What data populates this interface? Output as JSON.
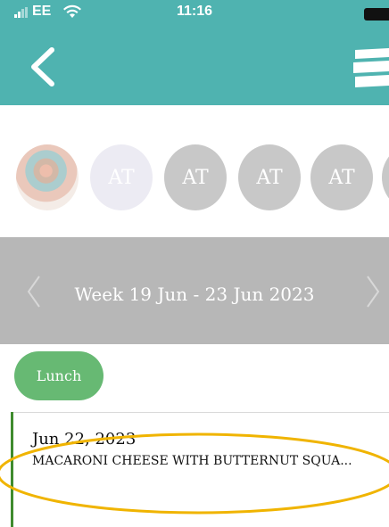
{
  "status_bar": {
    "carrier": "EE",
    "time": "11:16",
    "icons": [
      "signal-icon",
      "wifi-icon",
      "battery-icon"
    ]
  },
  "nav_bar": {
    "back_icon": "chevron-left-icon",
    "menu_icon": "menu-icon",
    "color": "#4fb3b0"
  },
  "children": [
    {
      "type": "photo"
    },
    {
      "initials": "AT",
      "selected": true
    },
    {
      "initials": "AT"
    },
    {
      "initials": "AT"
    },
    {
      "initials": "AT"
    }
  ],
  "week": {
    "label": "Week 19 Jun - 23 Jun 2023",
    "prev_icon": "chevron-left-icon",
    "next_icon": "chevron-right-icon"
  },
  "meal_filter": {
    "label": "Lunch",
    "color": "#67b973"
  },
  "entries": [
    {
      "date": "Jun 22, 2023",
      "meal": "MACARONI CHEESE WITH BUTTERNUT SQUA..."
    }
  ],
  "highlight_color": "#f0b400"
}
